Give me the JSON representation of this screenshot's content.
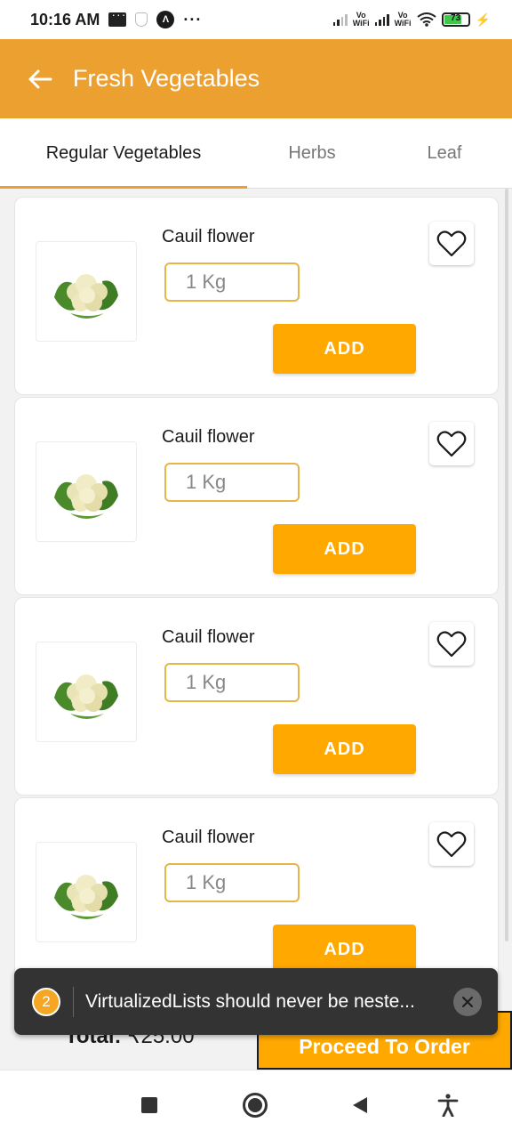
{
  "status_bar": {
    "time": "10:16 AM",
    "icons": [
      "message-icon",
      "shield-icon",
      "expo-icon",
      "more-dots-icon",
      "signal-icon",
      "vowifi-icon",
      "wifi-icon",
      "battery-icon",
      "charging-icon"
    ],
    "vowifi_label_1": "Vo",
    "vowifi_label_2": "WiFi",
    "battery_level": "73",
    "dots": "···"
  },
  "header": {
    "title": "Fresh Vegetables",
    "background_color": "#eca030"
  },
  "tabs": [
    {
      "label": "Regular Vegetables",
      "active": true
    },
    {
      "label": "Herbs",
      "active": false
    },
    {
      "label": "Leaf",
      "active": false
    }
  ],
  "products": [
    {
      "name": "Cauil flower",
      "quantity": "1 Kg",
      "add_label": "ADD"
    },
    {
      "name": "Cauil flower",
      "quantity": "1 Kg",
      "add_label": "ADD"
    },
    {
      "name": "Cauil flower",
      "quantity": "1 Kg",
      "add_label": "ADD"
    },
    {
      "name": "Cauil flower",
      "quantity": "1 Kg",
      "add_label": "ADD"
    }
  ],
  "footer": {
    "total_label": "Total:",
    "total_amount": "₹25.00",
    "proceed_label": "Proceed To Order"
  },
  "toast": {
    "count": "2",
    "message": "VirtualizedLists should never be neste..."
  },
  "colors": {
    "accent": "#ffa800",
    "header": "#eca030",
    "toast_bg": "#333333"
  }
}
